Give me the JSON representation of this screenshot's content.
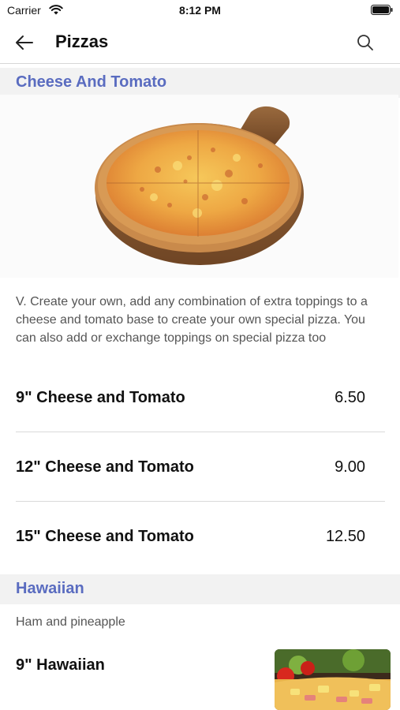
{
  "status_bar": {
    "carrier": "Carrier",
    "time": "8:12 PM",
    "wifi_icon": "wifi-icon",
    "battery_icon": "battery-icon"
  },
  "header": {
    "title": "Pizzas",
    "back_icon": "arrow-left-icon",
    "search_icon": "search-icon"
  },
  "sections": [
    {
      "title": "Cheese And Tomato",
      "image": "cheese-pizza-photo",
      "description": "V. Create your own, add any combination of extra toppings to a cheese and tomato base to create your own special pizza. You can also add or exchange toppings on special pizza too",
      "items": [
        {
          "name": "9\" Cheese and Tomato",
          "price": "6.50"
        },
        {
          "name": "12\" Cheese and Tomato",
          "price": "9.00"
        },
        {
          "name": "15\" Cheese and Tomato",
          "price": "12.50"
        }
      ]
    },
    {
      "title": "Hawaiian",
      "description": "Ham and pineapple",
      "items": [
        {
          "name": "9\" Hawaiian",
          "image": "hawaiian-pizza-photo"
        }
      ]
    }
  ],
  "colors": {
    "section_title": "#5a6cc0",
    "section_header_bg": "#f2f2f2",
    "divider": "#d9d9d9"
  }
}
